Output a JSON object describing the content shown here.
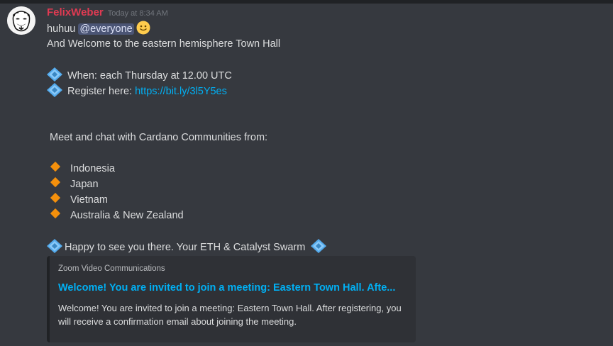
{
  "message": {
    "author": "FelixWeber",
    "timestamp": "Today at 8:34 AM",
    "greeting": "huhuu ",
    "mention": "@everyone",
    "welcome": "And Welcome to the eastern hemisphere Town Hall",
    "when": "When: each Thursday at 12.00 UTC",
    "register_label": "Register here: ",
    "register_link": "https://bit.ly/3l5Y5es",
    "meet": "Meet and chat with Cardano Communities from:",
    "communities": [
      "Indonesia",
      "Japan",
      "Vietnam",
      "Australia & New Zealand"
    ],
    "closing": "Happy to see you there. Your ETH & Catalyst Swarm"
  },
  "embed": {
    "provider": "Zoom Video Communications",
    "title": "Welcome! You are invited to join a meeting: Eastern Town Hall. Afte...",
    "description": "Welcome! You are invited to join a meeting: Eastern Town Hall. After registering, you will receive a confirmation email about joining the meeting."
  },
  "colors": {
    "background": "#36393f",
    "username": "#e03a52",
    "link": "#00b0f4",
    "embed_bg": "#2f3136"
  }
}
